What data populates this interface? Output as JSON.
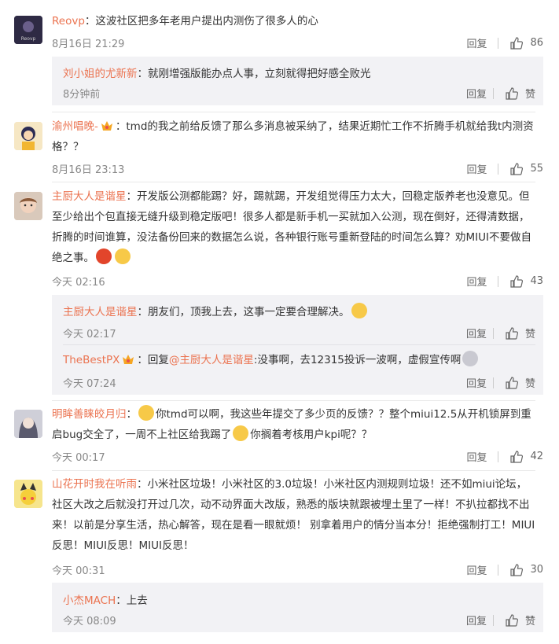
{
  "labels": {
    "reply": "回复",
    "like_word": "赞"
  },
  "comments": [
    {
      "user": "Reovp",
      "text": "：这波社区把多年老用户提出内测伤了很多人的心",
      "time": "8月16日 21:29",
      "likes": "86",
      "replies": [
        {
          "user": "刘小姐的尤新新",
          "text": "：就刚增强版能办点人事，立刻就得把好感全败光",
          "time": "8分钟前"
        }
      ]
    },
    {
      "user": "渝州唱晚-",
      "text": "：tmd的我之前给反馈了那么多消息被采纳了，结果近期忙工作不折腾手机就给我t内测资格？？",
      "time": "8月16日 23:13",
      "likes": "55",
      "replies": []
    },
    {
      "user": "主厨大人是谐星",
      "text": "：开发版公测都能踢？好，踢就踢，开发组觉得压力太大，回稳定版养老也没意见。但至少给出个包直接无缝升级到稳定版吧！很多人都是新手机一买就加入公测，现在倒好，还得清数据，折腾的时间谁算，没法备份回来的数据怎么说，各种银行账号重新登陆的时间怎么算？劝MIUI不要做自绝之事。",
      "time": "今天 02:16",
      "likes": "43",
      "replies": [
        {
          "user": "主厨大人是谐星",
          "text": "：朋友们，顶我上去，这事一定要合理解决。",
          "time": "今天 02:17"
        },
        {
          "user": "TheBestPX",
          "text_pre": "：回复",
          "mention": "@主厨大人是谐星",
          "text": ":没事啊，去12315投诉一波啊，虚假宣传啊",
          "time": "今天 07:24"
        }
      ]
    },
    {
      "user": "明眸善睐皎月归",
      "text_a": "：",
      "text_b": "你tmd可以啊，我这些年提交了多少页的反馈？？整个miui12.5从开机锁屏到重启bug交全了，一周不上社区给我踢了",
      "text_c": "你搁着考核用户kpi呢？？",
      "time": "今天 00:17",
      "likes": "42",
      "replies": []
    },
    {
      "user": "山花开时我在听雨",
      "text": "：小米社区垃圾！小米社区的3.0垃圾！小米社区内测规则垃圾！还不如miui论坛，社区大改之后就没打开过几次，动不动界面大改版，熟悉的版块就跟被埋土里了一样！不扒拉都找不出来！以前是分享生活，热心解答，现在是看一眼就烦！ 别拿着用户的情分当本分！拒绝强制打工！MIUI反思！MIUI反思！MIUI反思！",
      "time": "今天 00:31",
      "likes": "30",
      "replies": [
        {
          "user": "小杰MACH",
          "text": "：上去",
          "time": "今天 08:09"
        }
      ]
    }
  ]
}
